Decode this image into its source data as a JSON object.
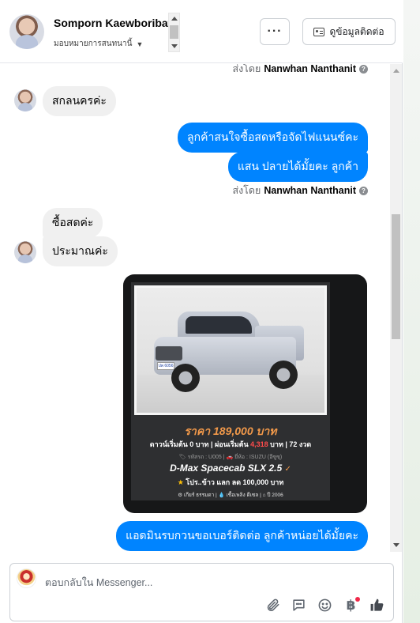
{
  "header": {
    "name": "Somporn Kaewboribat",
    "assign_label": "มอบหมายการสนทนานี้",
    "contact_button": "ดูข้อมูลติดต่อ",
    "more_button": "···"
  },
  "messages": {
    "sent_by_1": {
      "prefix": "ส่งโดย",
      "name": "Nanwhan Nanthanit"
    },
    "in_1": "สกลนครค่ะ",
    "out_1": "ลูกค้าสนใจซื้อสดหรือจัดไฟแนนซ์คะ",
    "out_2": "แสน ปลายได้มั้ยคะ ลูกค้า",
    "sent_by_2": {
      "prefix": "ส่งโดย",
      "name": "Nanwhan Nanthanit"
    },
    "in_2": "ซื้อสดค่ะ",
    "in_3": "ประมาณค่ะ",
    "out_3": "แอดมินรบกวนขอเบอร์ติดต่อ ลูกค้าหน่อยได้มั้ยคะ"
  },
  "promo": {
    "price": "ราคา 189,000 บาท",
    "terms_pre": "ดาวน์เริ่มต้น 0 บาท | ผ่อนเริ่มต้น ",
    "terms_amount": "4,318",
    "terms_post": " บาท | 72 งวด",
    "specs": "🏷 รหัสรถ : U005 | 🚗 ยี่ห้อ : ISUZU (อีซูซุ)",
    "model": "D-Max Spacecab SLX 2.5",
    "promo_text": "โปร..ข้าว แลก ลด 100,000 บาท",
    "footer": "⚙ เกียร์ ธรรมดา   |   💧 เชื้อเพลิง ดีเซล   |   ⌂ ปี 2006",
    "plate": "ปพ 6056"
  },
  "composer": {
    "placeholder": "ตอบกลับใน Messenger..."
  },
  "colors": {
    "outgoing": "#0084ff",
    "incoming": "#f0f0f0",
    "price_accent": "#f2994a"
  }
}
